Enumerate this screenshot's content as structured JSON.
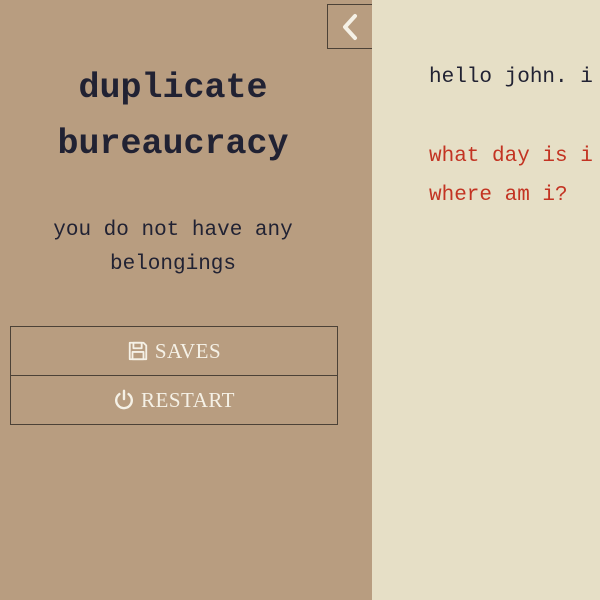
{
  "sidebar": {
    "title_line1": "duplicate",
    "title_line2": "bureaucracy",
    "inventory_line1": "you do not have any",
    "inventory_line2": "belongings",
    "saves_label": "SAVES",
    "restart_label": "RESTART",
    "saves_icon": "save-disk-icon",
    "restart_icon": "power-icon",
    "collapse_icon": "chevron-left-icon"
  },
  "passage": {
    "text": "hello john. i",
    "links": [
      "what day is i",
      "where am i?"
    ]
  },
  "colors": {
    "sidebar_bg": "#b89d80",
    "passage_bg": "#e6dfc6",
    "text": "#212233",
    "link": "#c33322",
    "button_text": "#f5f1e6"
  }
}
